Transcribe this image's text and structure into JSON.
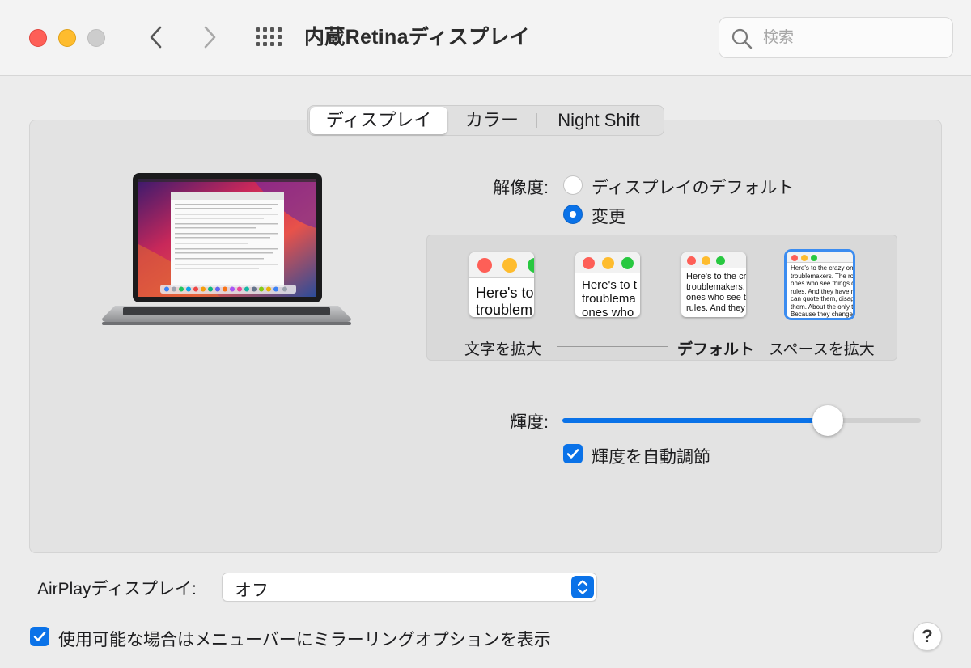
{
  "window": {
    "title": "内蔵Retinaディスプレイ",
    "search_placeholder": "検索"
  },
  "tabs": [
    {
      "label": "ディスプレイ",
      "active": true
    },
    {
      "label": "カラー",
      "active": false
    },
    {
      "label": "Night Shift",
      "active": false
    }
  ],
  "resolution": {
    "label": "解像度:",
    "options": [
      {
        "label": "ディスプレイのデフォルト",
        "selected": false
      },
      {
        "label": "変更",
        "selected": true
      }
    ],
    "scale_labels": {
      "larger_text": "文字を拡大",
      "default": "デフォルト",
      "more_space": "スペースを拡大"
    },
    "selected_scale_index": 3,
    "thumbnails": [
      {
        "lines": [
          "Here's to",
          "troublem"
        ]
      },
      {
        "lines": [
          "Here's to t",
          "troublema",
          "ones who"
        ]
      },
      {
        "lines": [
          "Here's to the cr",
          "troublemakers.",
          "ones who see t",
          "rules. And they"
        ]
      },
      {
        "lines": [
          "Here's to the crazy ones",
          "troublemakers. The rou",
          "ones who see things di",
          "rules. And they have no",
          "can quote them, disagr",
          "them. About the only th",
          "Because they change th"
        ]
      }
    ]
  },
  "brightness": {
    "label": "輝度:",
    "value": 0.74,
    "auto_label": "輝度を自動調節",
    "auto_checked": true
  },
  "airplay": {
    "label": "AirPlayディスプレイ:",
    "value": "オフ"
  },
  "mirroring": {
    "label": "使用可能な場合はメニューバーにミラーリングオプションを表示",
    "checked": true
  },
  "help": {
    "label": "?"
  },
  "colors": {
    "accent": "#0a72e8",
    "close": "#fe5f57",
    "minimize": "#febc2e",
    "zoom_disabled": "#cdcdcd"
  }
}
